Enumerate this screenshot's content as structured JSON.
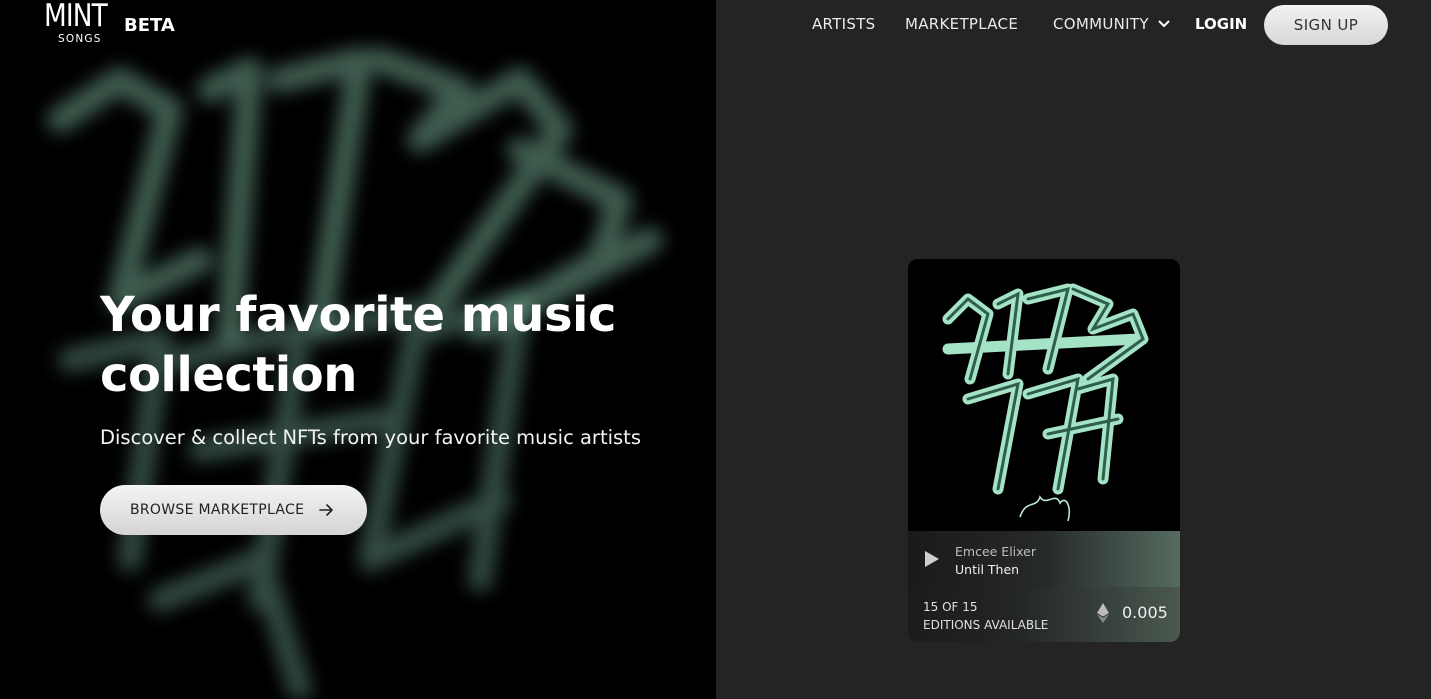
{
  "brand": {
    "logo_main": "MINT",
    "logo_sub": "SONGS",
    "badge": "BETA"
  },
  "nav": {
    "artists": "ARTISTS",
    "marketplace": "MARKETPLACE",
    "community": "COMMUNITY",
    "login": "LOGIN",
    "signup": "SIGN UP"
  },
  "hero": {
    "title": "Your favorite music collection",
    "subtitle": "Discover & collect NFTs from your favorite music artists",
    "cta": "BROWSE MARKETPLACE"
  },
  "card": {
    "artist": "Emcee Elixer",
    "track": "Until Then",
    "editions_line1": "15 OF 15",
    "editions_line2": "EDITIONS AVAILABLE",
    "price": "0.005",
    "currency_icon": "ethereum-icon"
  },
  "colors": {
    "accent_mint": "#8fd3b6",
    "background_dark": "#242424",
    "hero_black": "#000000",
    "button_light": "#e6e6e6"
  }
}
